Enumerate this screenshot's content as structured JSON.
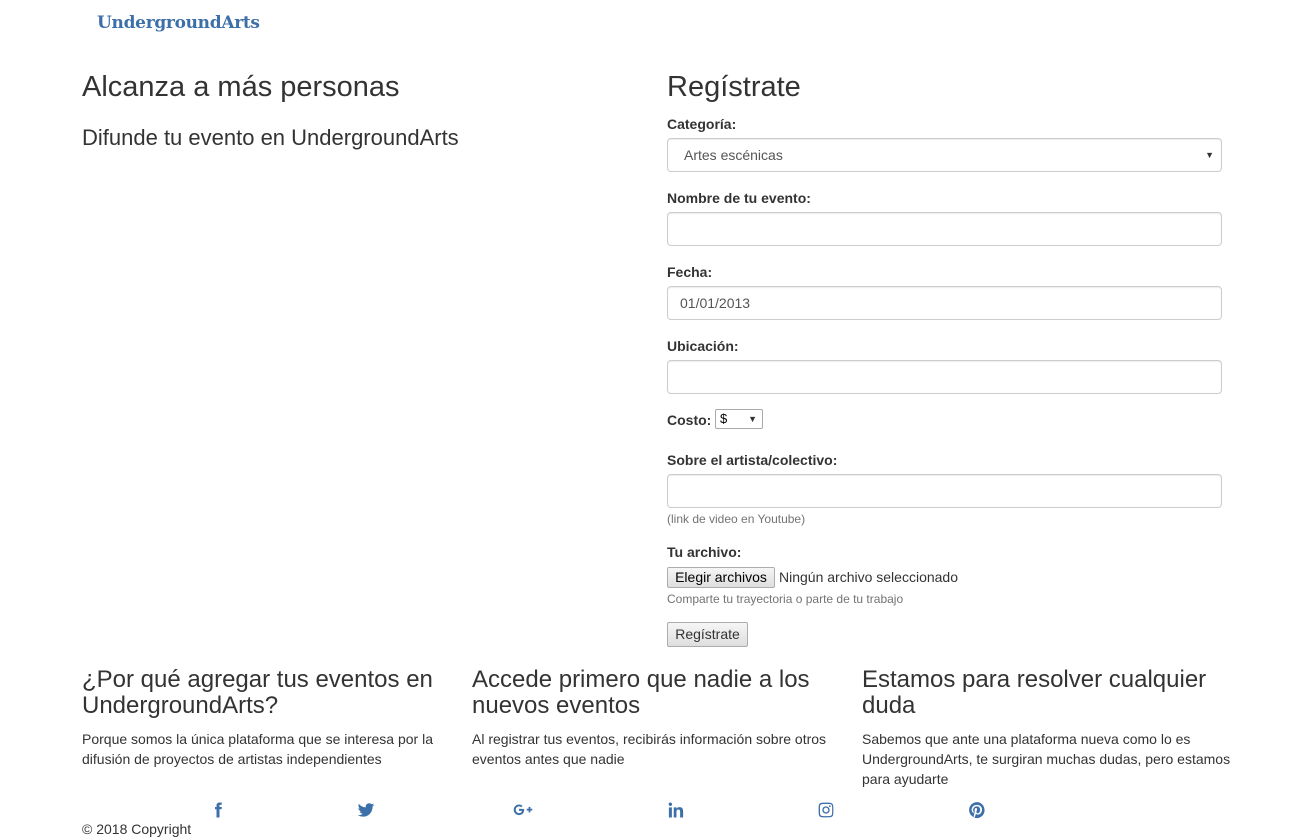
{
  "brand": {
    "logo_text": "UndergroundArts",
    "accent_color": "#3d6fa8"
  },
  "hero": {
    "title": "Alcanza a más personas",
    "subtitle": "Difunde tu evento en UndergroundArts"
  },
  "form": {
    "title": "Regístrate",
    "category": {
      "label": "Categoría:",
      "value": "Artes escénicas"
    },
    "event_name": {
      "label": "Nombre de tu evento:",
      "value": ""
    },
    "date": {
      "label": "Fecha:",
      "value": "01/01/2013"
    },
    "location": {
      "label": "Ubicación:",
      "value": ""
    },
    "cost": {
      "label": "Costo:",
      "value": "$"
    },
    "artist": {
      "label": "Sobre el artista/colectivo:",
      "value": "",
      "help": "(link de video en Youtube)"
    },
    "file": {
      "label": "Tu archivo:",
      "button": "Elegir archivos",
      "status": "Ningún archivo seleccionado",
      "help": "Comparte tu trayectoria o parte de tu trabajo"
    },
    "submit": "Regístrate"
  },
  "features": [
    {
      "title": "¿Por qué agregar tus eventos en UndergroundArts?",
      "text": "Porque somos la única plataforma que se interesa por la difusión de proyectos de artistas independientes"
    },
    {
      "title": "Accede primero que nadie a los nuevos eventos",
      "text": "Al registrar tus eventos, recibirás información sobre otros eventos antes que nadie"
    },
    {
      "title": "Estamos para resolver cualquier duda",
      "text": "Sabemos que ante una plataforma nueva como lo es UndergroundArts, te surgiran muchas dudas, pero estamos para ayudarte"
    }
  ],
  "footer": {
    "social": [
      "facebook-icon",
      "twitter-icon",
      "google-plus-icon",
      "linkedin-icon",
      "instagram-icon",
      "pinterest-icon"
    ],
    "copyright": "© 2018 Copyright"
  }
}
